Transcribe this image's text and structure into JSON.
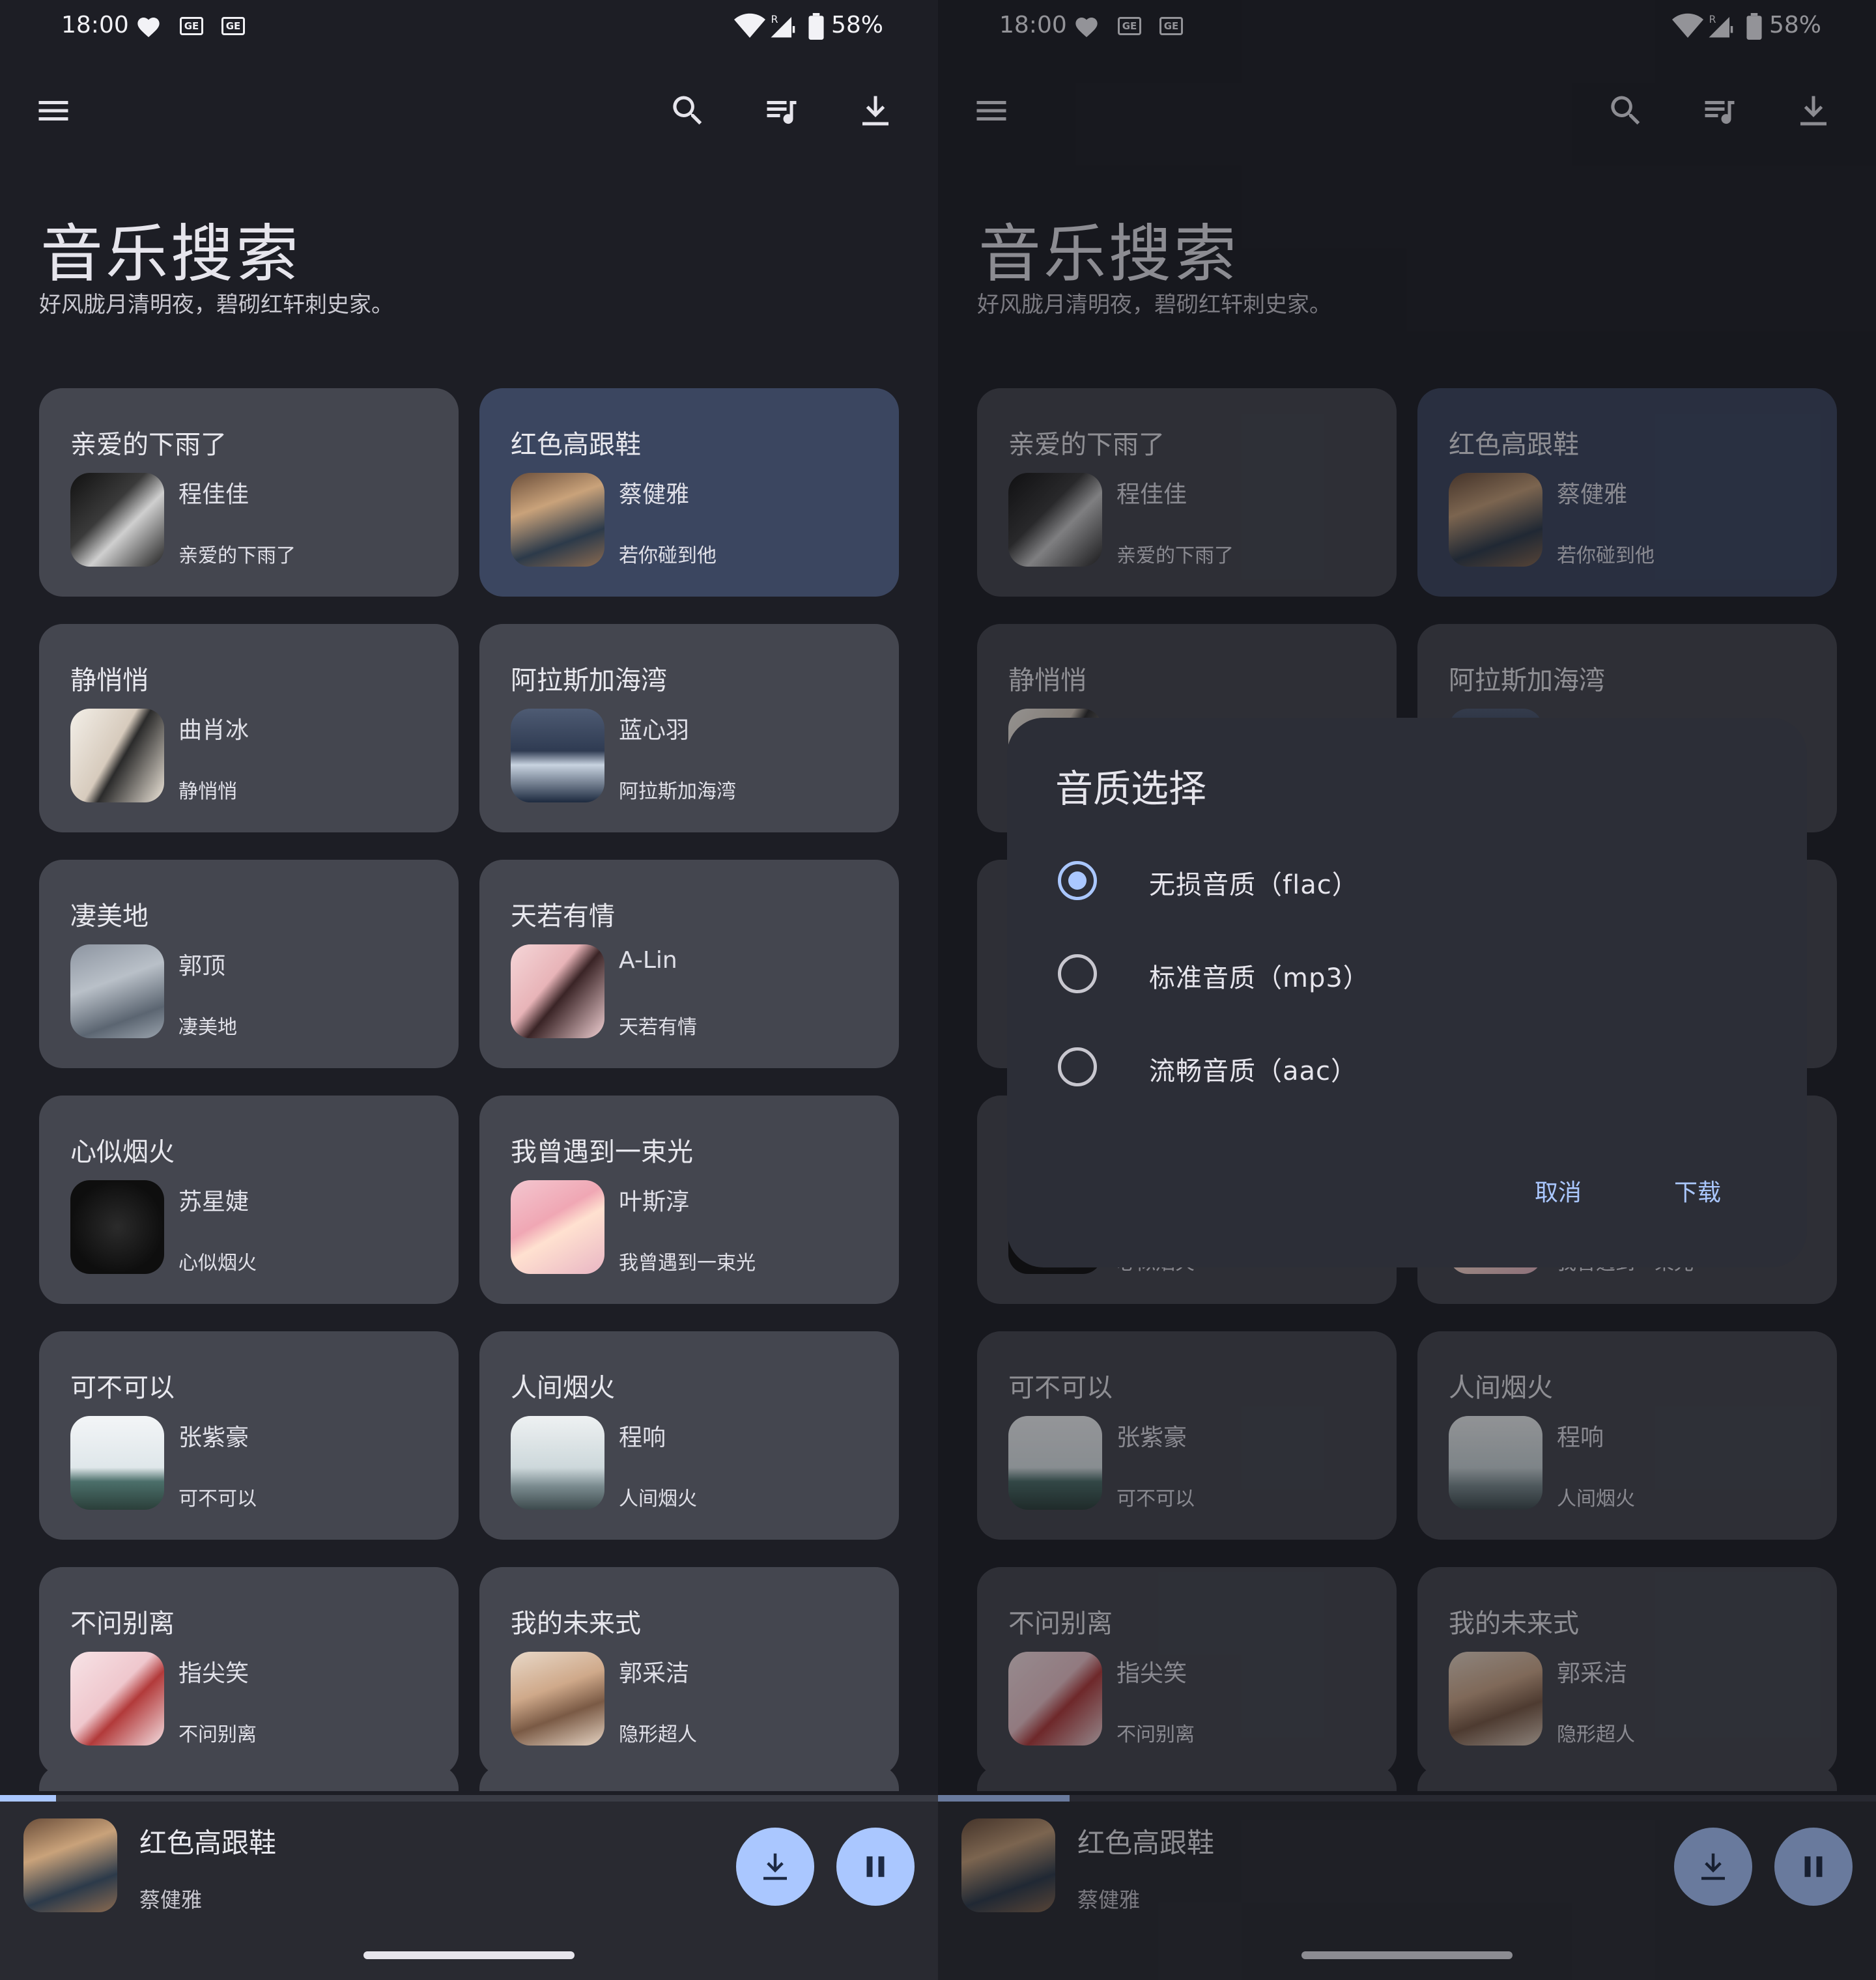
{
  "status": {
    "time": "18:00",
    "sim1": "GE",
    "sim2": "GE",
    "roaming": "R",
    "battery": "58%"
  },
  "page": {
    "title": "音乐搜索",
    "subtitle": "好风胧月清明夜，碧砌红轩刺史家。"
  },
  "songs": [
    {
      "title": "亲爱的下雨了",
      "artist": "程佳佳",
      "album": "亲爱的下雨了"
    },
    {
      "title": "红色高跟鞋",
      "artist": "蔡健雅",
      "album": "若你碰到他"
    },
    {
      "title": "静悄悄",
      "artist": "曲肖冰",
      "album": "静悄悄"
    },
    {
      "title": "阿拉斯加海湾",
      "artist": "蓝心羽",
      "album": "阿拉斯加海湾"
    },
    {
      "title": "凄美地",
      "artist": "郭顶",
      "album": "凄美地"
    },
    {
      "title": "天若有情",
      "artist": "A-Lin",
      "album": "天若有情"
    },
    {
      "title": "心似烟火",
      "artist": "苏星婕",
      "album": "心似烟火"
    },
    {
      "title": "我曾遇到一束光",
      "artist": "叶斯淳",
      "album": "我曾遇到一束光"
    },
    {
      "title": "可不可以",
      "artist": "张紫豪",
      "album": "可不可以"
    },
    {
      "title": "人间烟火",
      "artist": "程响",
      "album": "人间烟火"
    },
    {
      "title": "不问别离",
      "artist": "指尖笑",
      "album": "不问别离"
    },
    {
      "title": "我的未来式",
      "artist": "郭采洁",
      "album": "隐形超人"
    }
  ],
  "active_song_index": 1,
  "player": {
    "title": "红色高跟鞋",
    "artist": "蔡健雅",
    "progress": 0.06,
    "progress_right": 0.14
  },
  "dialog": {
    "title": "音质选择",
    "options": [
      "无损音质（flac）",
      "标准音质（mp3）",
      "流畅音质（aac）"
    ],
    "selected": 0,
    "cancel": "取消",
    "confirm": "下载"
  },
  "icons": {
    "menu": "menu-icon",
    "search": "search-icon",
    "queue": "queue-music-icon",
    "download": "download-icon",
    "pause": "pause-icon"
  },
  "colors": {
    "accent": "#aac7ff",
    "card": "#44464f",
    "card_active": "#3b4660",
    "background": "#1d1e25"
  }
}
